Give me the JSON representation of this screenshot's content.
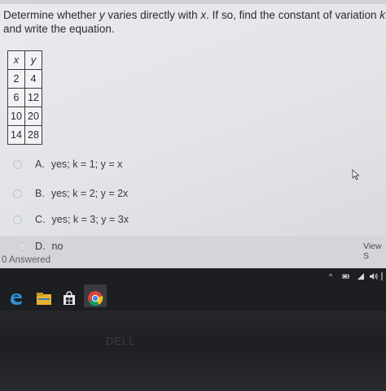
{
  "question": {
    "text_pre": "Determine whether ",
    "var_y": "y",
    "text_mid1": " varies directly with ",
    "var_x": "x",
    "text_mid2": ". If so, find the constant of variation ",
    "var_k": "k",
    "text_post": " and write the equation."
  },
  "table": {
    "headers": [
      "x",
      "y"
    ],
    "rows": [
      [
        "2",
        "4"
      ],
      [
        "6",
        "12"
      ],
      [
        "10",
        "20"
      ],
      [
        "14",
        "28"
      ]
    ]
  },
  "options": [
    {
      "letter": "A.",
      "text": "yes; k = 1; y = x"
    },
    {
      "letter": "B.",
      "text": "yes; k = 2; y = 2x"
    },
    {
      "letter": "C.",
      "text": "yes; k = 3; y = 3x"
    },
    {
      "letter": "D.",
      "text": "no"
    }
  ],
  "footer": {
    "answered": "0 Answered",
    "view_button": "View S"
  },
  "taskbar": {
    "tray_chevron": "^"
  },
  "icons": {
    "edge": "edge-browser-icon",
    "explorer": "file-explorer-icon",
    "store": "store-icon",
    "chrome": "chrome-icon"
  },
  "colors": {
    "screen_bg": "#e5e6eb",
    "text": "#2a2a30",
    "edge_blue": "#2f8fd8",
    "taskbar": "#1d1e22"
  }
}
